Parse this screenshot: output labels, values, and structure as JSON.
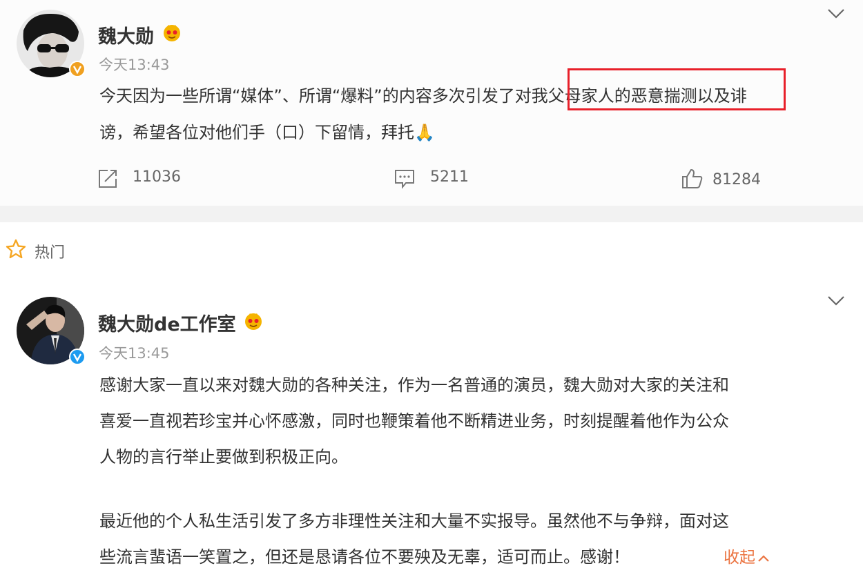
{
  "post1": {
    "author": "魏大勋",
    "time": "今天13:43",
    "text_line1_a": "今天因为一些所谓“媒体”、所谓“爆料”的内容多次引发了",
    "text_line1_highlight": "对我父母家人的恶意揣测",
    "text_line1_b": "以及诽",
    "text_line2": "谤，希望各位对他们手（口）下留情，拜托🙏",
    "reposts": "11036",
    "comments": "5211",
    "likes": "81284"
  },
  "hot_section": {
    "label": "热门"
  },
  "post2": {
    "author": "魏大勋de工作室",
    "time": "今天13:45",
    "para1_line1": "感谢大家一直以来对魏大勋的各种关注，作为一名普通的演员，魏大勋对大家的关注和",
    "para1_line2": "喜爱一直视若珍宝并心怀感激，同时也鞭策着他不断精进业务，时刻提醒着他作为公众",
    "para1_line3": "人物的言行举止要做到积极正向。",
    "para2_line1": "最近他的个人私生活引发了多方非理性关注和大量不实报导。虽然他不与争辩，面对这",
    "para2_line2": "些流言蜚语一笑置之，但还是恳请各位不要殃及无辜，适可而止。感谢！",
    "collapse_label": "收起"
  },
  "colors": {
    "highlight_border": "#e8202a",
    "verified_gold": "#f0a020",
    "verified_blue": "#1d9bf0",
    "collapse_orange": "#eb7340",
    "hot_star": "#f5a623"
  },
  "icons": {
    "repost": "share-icon",
    "comment": "comment-icon",
    "like": "thumbs-up-icon",
    "menu": "chevron-down-icon",
    "vip": "vip-badge-icon",
    "hot": "star-icon"
  }
}
